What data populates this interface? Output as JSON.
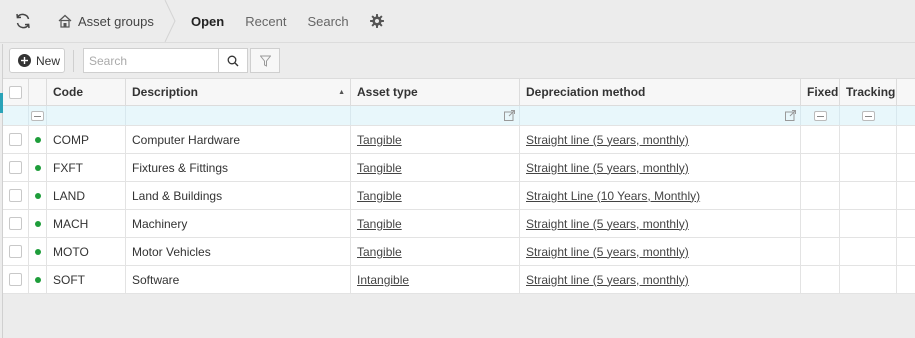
{
  "header": {
    "refresh_icon": "refresh-icon",
    "breadcrumb_label": "Asset groups",
    "tabs": [
      {
        "label": "Open"
      },
      {
        "label": "Recent"
      },
      {
        "label": "Search"
      }
    ]
  },
  "toolbar": {
    "new_label": "New",
    "search_placeholder": "Search"
  },
  "grid": {
    "columns": {
      "code": "Code",
      "description": "Description",
      "asset_type": "Asset type",
      "depreciation_method": "Depreciation method",
      "fixed": "Fixed",
      "tracking": "Tracking"
    },
    "sort_indicator": "▲",
    "rows": [
      {
        "code": "COMP",
        "description": "Computer Hardware",
        "asset_type": "Tangible",
        "depreciation_method": "Straight line (5 years, monthly)"
      },
      {
        "code": "FXFT",
        "description": "Fixtures & Fittings",
        "asset_type": "Tangible",
        "depreciation_method": "Straight line (5 years, monthly)"
      },
      {
        "code": "LAND",
        "description": "Land & Buildings",
        "asset_type": "Tangible",
        "depreciation_method": "Straight Line (10 Years, Monthly)"
      },
      {
        "code": "MACH",
        "description": "Machinery",
        "asset_type": "Tangible",
        "depreciation_method": "Straight line (5 years, monthly)"
      },
      {
        "code": "MOTO",
        "description": "Motor Vehicles",
        "asset_type": "Tangible",
        "depreciation_method": "Straight line (5 years, monthly)"
      },
      {
        "code": "SOFT",
        "description": "Software",
        "asset_type": "Intangible",
        "depreciation_method": "Straight line (5 years, monthly)"
      }
    ]
  },
  "colors": {
    "active_dot": "#1e9d3a",
    "accent": "#2aa3b8",
    "filter_row": "#e8f7fb"
  }
}
